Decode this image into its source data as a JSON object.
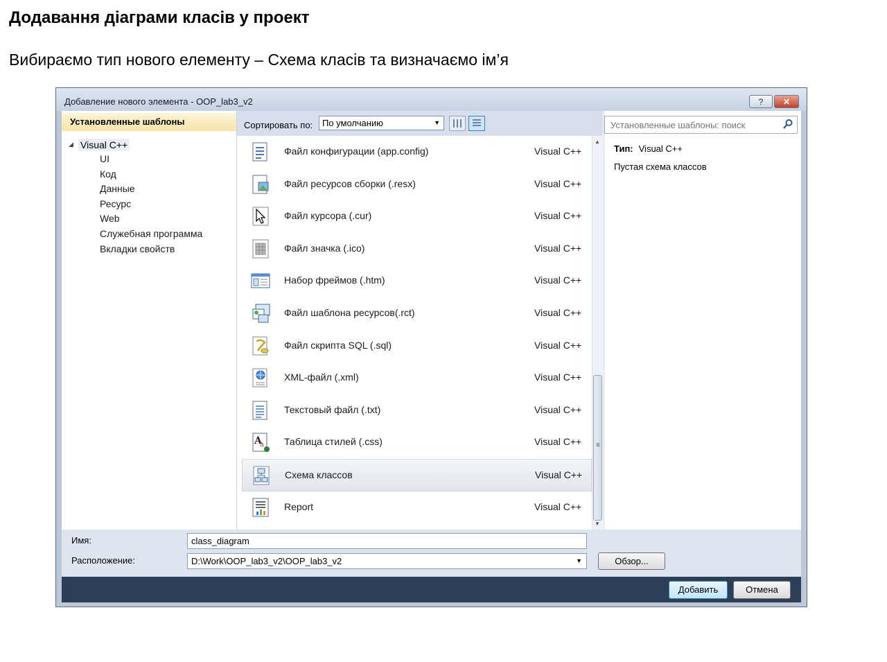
{
  "slide": {
    "title": "Додавання діаграми класів у проект",
    "subtitle": "Вибираємо тип нового елементу – Схема класів та визначаємо ім’я"
  },
  "dialog": {
    "title": "Добавление нового элемента - OOP_lab3_v2",
    "help_label": "?",
    "close_label": "✕",
    "installed_header": "Установленные шаблоны",
    "tree": {
      "root": "Visual C++",
      "children": [
        "UI",
        "Код",
        "Данные",
        "Ресурс",
        "Web",
        "Служебная программа",
        "Вкладки свойств"
      ]
    },
    "sort_label": "Сортировать по:",
    "sort_value": "По умолчанию",
    "search_placeholder": "Установленные шаблоны: поиск",
    "templates": [
      {
        "name": "Файл конфигурации (app.config)",
        "lang": "Visual C++",
        "icon": "config-file-icon"
      },
      {
        "name": "Файл ресурсов сборки (.resx)",
        "lang": "Visual C++",
        "icon": "resx-file-icon"
      },
      {
        "name": "Файл курсора (.cur)",
        "lang": "Visual C++",
        "icon": "cursor-file-icon"
      },
      {
        "name": "Файл значка (.ico)",
        "lang": "Visual C++",
        "icon": "icon-file-icon"
      },
      {
        "name": "Набор фреймов (.htm)",
        "lang": "Visual C++",
        "icon": "frameset-file-icon"
      },
      {
        "name": "Файл шаблона ресурсов(.rct)",
        "lang": "Visual C++",
        "icon": "resource-template-icon"
      },
      {
        "name": "Файл скрипта SQL (.sql)",
        "lang": "Visual C++",
        "icon": "sql-script-icon"
      },
      {
        "name": "XML-файл (.xml)",
        "lang": "Visual C++",
        "icon": "xml-file-icon"
      },
      {
        "name": "Текстовый файл (.txt)",
        "lang": "Visual C++",
        "icon": "text-file-icon"
      },
      {
        "name": "Таблица стилей (.css)",
        "lang": "Visual C++",
        "icon": "stylesheet-icon"
      },
      {
        "name": "Схема классов",
        "lang": "Visual C++",
        "icon": "class-diagram-icon",
        "selected": true
      },
      {
        "name": "Report",
        "lang": "Visual C++",
        "icon": "report-icon"
      }
    ],
    "details": {
      "type_label": "Тип:",
      "type_value": "Visual C++",
      "description": "Пустая схема классов"
    },
    "name_label": "Имя:",
    "name_value": "class_diagram",
    "location_label": "Расположение:",
    "location_value": "D:\\Work\\OOP_lab3_v2\\OOP_lab3_v2",
    "browse_label": "Обзор...",
    "add_label": "Добавить",
    "cancel_label": "Отмена"
  }
}
